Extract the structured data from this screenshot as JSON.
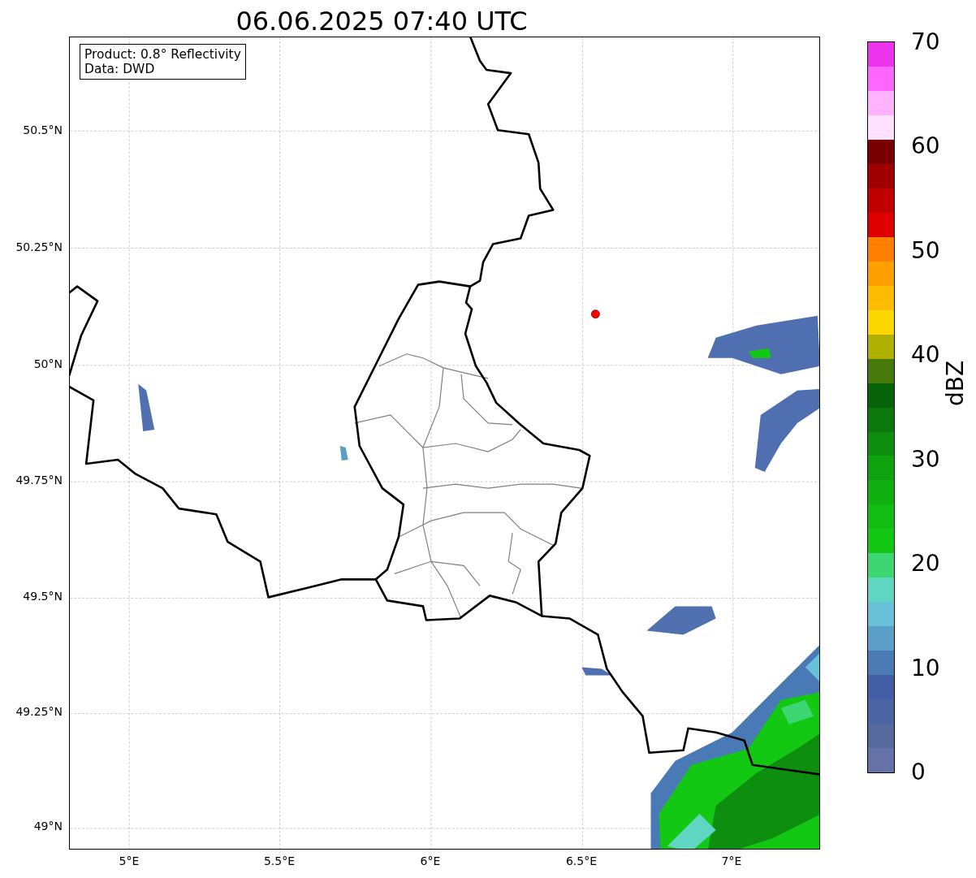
{
  "title": "06.06.2025 07:40 UTC",
  "map": {
    "annotation": [
      "Product: 0.8° Reflectivity",
      "Data: DWD"
    ],
    "lat_ticks": [
      "50.5°N",
      "50.25°N",
      "50°N",
      "49.75°N",
      "49.5°N",
      "49.25°N",
      "49°N"
    ],
    "lon_ticks": [
      "5°E",
      "5.5°E",
      "6°E",
      "6.5°E",
      "7°E"
    ]
  },
  "colorbar": {
    "label": "dBZ",
    "ticks": [
      "70",
      "60",
      "50",
      "40",
      "30",
      "20",
      "10",
      "0"
    ],
    "bins": [
      {
        "color": "#ee33ee"
      },
      {
        "color": "#ff66ff"
      },
      {
        "color": "#ffb3ff"
      },
      {
        "color": "#ffe0ff"
      },
      {
        "color": "#780000"
      },
      {
        "color": "#a00000"
      },
      {
        "color": "#c00000"
      },
      {
        "color": "#e00000"
      },
      {
        "color": "#ff7f00"
      },
      {
        "color": "#ff9f00"
      },
      {
        "color": "#ffbb00"
      },
      {
        "color": "#ffd700"
      },
      {
        "color": "#b0b000"
      },
      {
        "color": "#477a0a"
      },
      {
        "color": "#076307"
      },
      {
        "color": "#0b780b"
      },
      {
        "color": "#0e8e0e"
      },
      {
        "color": "#0fa20f"
      },
      {
        "color": "#10b010"
      },
      {
        "color": "#11bd11"
      },
      {
        "color": "#12c812"
      },
      {
        "color": "#3cd673"
      },
      {
        "color": "#5fd6c2"
      },
      {
        "color": "#66c1d9"
      },
      {
        "color": "#5b9ec7"
      },
      {
        "color": "#4b7bb5"
      },
      {
        "color": "#415ea6"
      },
      {
        "color": "#4a64a4"
      },
      {
        "color": "#56699e"
      },
      {
        "color": "#6472a8"
      }
    ]
  }
}
